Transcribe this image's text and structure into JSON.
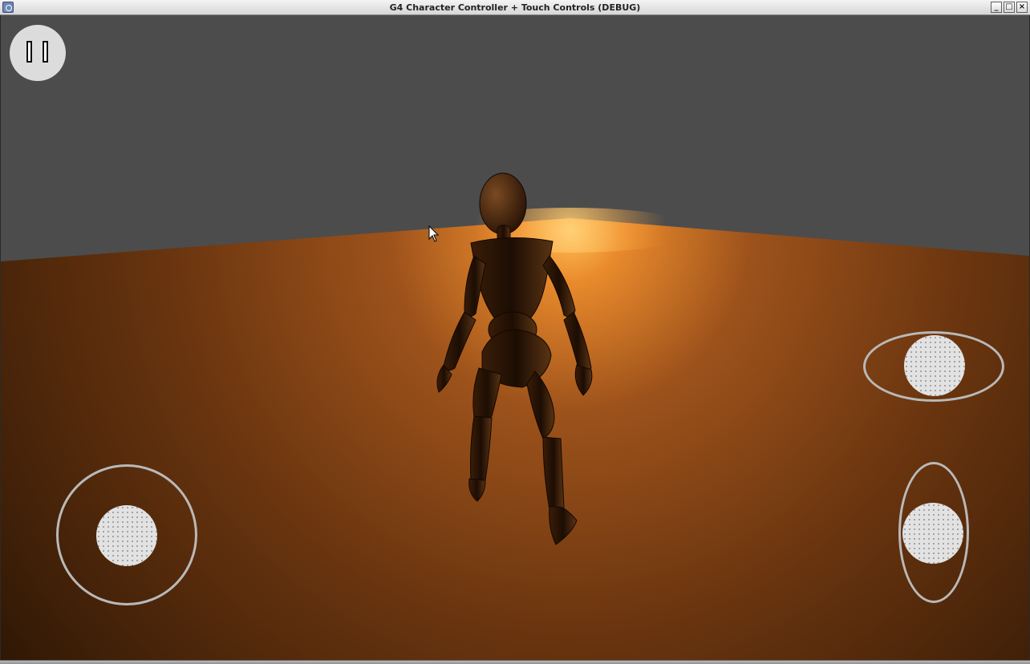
{
  "window": {
    "title": "G4 Character Controller + Touch Controls (DEBUG)",
    "controls": {
      "minimize": "_",
      "maximize": "□",
      "close": "×"
    }
  },
  "scene": {
    "sky_color": "#4c4c4c",
    "ground_color": "#7a3f12",
    "light_color": "#ffb347",
    "character": "wooden-mannequin"
  },
  "hud": {
    "pause_icon": "pause-icon",
    "joysticks": [
      {
        "name": "move-joystick",
        "shape": "circle"
      },
      {
        "name": "look-horizontal-joystick",
        "shape": "horizontal-ellipse"
      },
      {
        "name": "look-vertical-joystick",
        "shape": "vertical-ellipse"
      }
    ]
  }
}
